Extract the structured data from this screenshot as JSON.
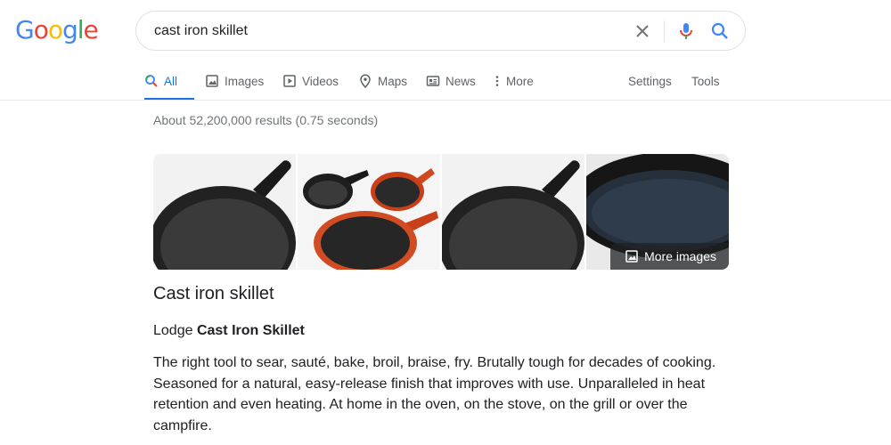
{
  "logo": {
    "letters": [
      "G",
      "o",
      "o",
      "g",
      "l",
      "e"
    ],
    "colors": [
      "#4285F4",
      "#EA4335",
      "#FBBC05",
      "#4285F4",
      "#34A853",
      "#EA4335"
    ]
  },
  "search": {
    "query": "cast iron skillet",
    "clear_icon": "close-icon",
    "mic_icon": "mic-icon",
    "search_icon": "search-icon"
  },
  "tabs": [
    {
      "label": "All",
      "icon": "search-icon",
      "active": true
    },
    {
      "label": "Images",
      "icon": "image-icon"
    },
    {
      "label": "Videos",
      "icon": "video-icon"
    },
    {
      "label": "Maps",
      "icon": "map-pin-icon"
    },
    {
      "label": "News",
      "icon": "news-icon"
    },
    {
      "label": "More",
      "icon": "more-vert-icon"
    }
  ],
  "tools": {
    "settings": "Settings",
    "tools": "Tools"
  },
  "result_stats": "About 52,200,000 results (0.75 seconds)",
  "images": {
    "more_label": "More images"
  },
  "knowledge_panel": {
    "title": "Cast iron skillet",
    "subtitle_plain": "Lodge ",
    "subtitle_bold": "Cast Iron Skillet",
    "description": "The right tool to sear, sauté, bake, broil, braise, fry. Brutally tough for decades of cooking. Seasoned for a natural, easy-release finish that improves with use. Unparalleled in heat retention and even heating. At home in the oven, on the stove, on the grill or over the campfire."
  },
  "colors": {
    "accent": "#1a73e8",
    "text": "#202124",
    "muted": "#70757a",
    "tab": "#5f6368"
  }
}
